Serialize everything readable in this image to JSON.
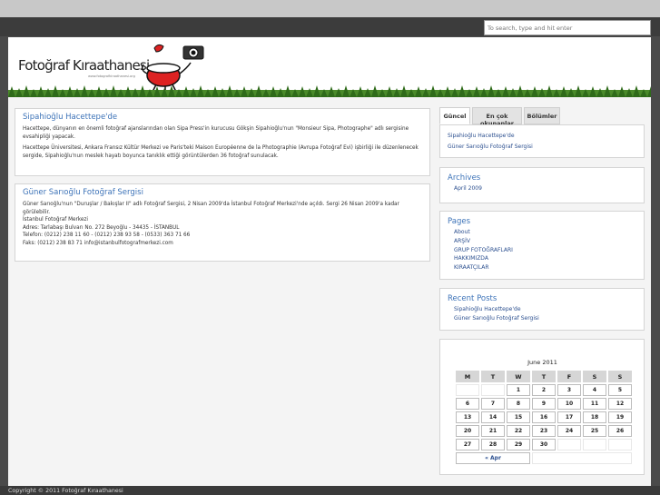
{
  "search": {
    "placeholder": "To search, type and hit enter"
  },
  "header": {
    "logo_text": "Fotoğraf Kıraathanesi",
    "logo_sub": "www.fotografkiraathanesi.org"
  },
  "posts": [
    {
      "title": "Sipahioğlu Hacettepe'de",
      "paragraphs": [
        "Hacettepe, dünyanın en önemli fotoğraf ajanslarından olan Sipa Press'in kurucusu Gökşin Sipahioğlu'nun \"Monsieur Sipa, Photographe\" adlı sergisine evsahipliği yapacak.",
        "Hacettepe Üniversitesi, Ankara Fransız Kültür Merkezi ve Paris'teki Maison Européenne de la Photographie (Avrupa Fotoğraf Evi) işbirliği ile düzenlenecek sergide, Sipahioğlu'nun meslek hayatı boyunca tanıklık ettiği görüntülerden 36 fotoğraf sunulacak."
      ]
    },
    {
      "title": "Güner Sarıoğlu Fotoğraf Sergisi",
      "paragraphs": [
        "Güner Sarıoğlu'nun \"Duruşlar / Bakışlar II\" adlı Fotoğraf Sergisi, 2 Nisan 2009'da İstanbul Fotoğraf Merkezi'nde açıldı. Sergi 26 Nisan 2009'a kadar görülebilir.",
        "İstanbul Fotoğraf Merkezi",
        "Adres: Tarlabaşı Bulvarı No. 272 Beyoğlu - 34435 - İSTANBUL",
        "Telefon: (0212) 238 11 60 - (0212) 238 93 58 - (0533) 363 71 66",
        "Faks: (0212) 238 83 71 info@istanbulfotografmerkezi.com"
      ]
    }
  ],
  "tabs": [
    "Güncel",
    "En çok okunanlar",
    "Bölümler"
  ],
  "tab_items": [
    "Sipahioğlu Hacettepe'de",
    "Güner Sarıoğlu Fotoğraf Sergisi"
  ],
  "archives": {
    "title": "Archives",
    "items": [
      "April 2009"
    ]
  },
  "pages": {
    "title": "Pages",
    "items": [
      "About",
      "ARŞİV",
      "GRUP FOTOĞRAFLARI",
      "HAKKIMIZDA",
      "KIRAATÇILAR"
    ]
  },
  "recent_posts": {
    "title": "Recent Posts",
    "items": [
      "Sipahioğlu Hacettepe'de",
      "Güner Sarıoğlu Fotoğraf Sergisi"
    ]
  },
  "calendar": {
    "caption": "June 2011",
    "weekdays": [
      "M",
      "T",
      "W",
      "T",
      "F",
      "S",
      "S"
    ],
    "weeks": [
      [
        "",
        "",
        "1",
        "2",
        "3",
        "4",
        "5"
      ],
      [
        "6",
        "7",
        "8",
        "9",
        "10",
        "11",
        "12"
      ],
      [
        "13",
        "14",
        "15",
        "16",
        "17",
        "18",
        "19"
      ],
      [
        "20",
        "21",
        "22",
        "23",
        "24",
        "25",
        "26"
      ],
      [
        "27",
        "28",
        "29",
        "30",
        "",
        "",
        ""
      ]
    ],
    "prev_link": "« Apr"
  },
  "footer": {
    "text": "Copyright © 2011 Fotoğraf Kıraathanesi"
  }
}
